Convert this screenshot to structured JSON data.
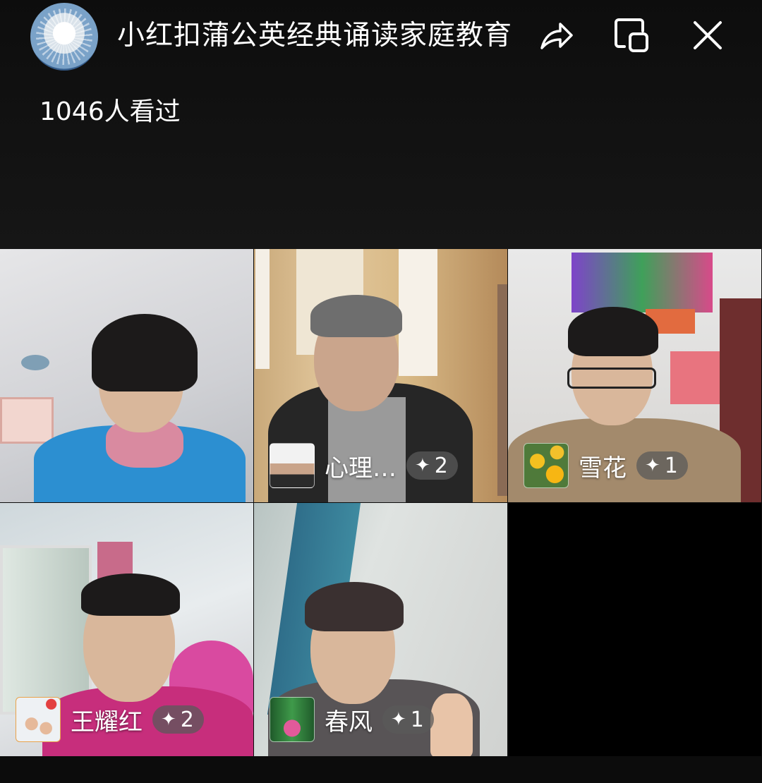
{
  "header": {
    "title": "小红扣蒲公英经典诵读家庭教育",
    "viewers": "1046人看过",
    "avatar_icon": "dandelion-avatar",
    "buttons": {
      "share_icon": "share-icon",
      "float_icon": "floating-window-icon",
      "close_icon": "close-icon"
    }
  },
  "participants": [
    {
      "name": "",
      "badge": ""
    },
    {
      "name": "心理…",
      "badge": "2",
      "avatar_icon": "man-portrait-avatar"
    },
    {
      "name": "雪花",
      "badge": "1",
      "avatar_icon": "yellow-flowers-avatar"
    },
    {
      "name": "王耀红",
      "badge": "2",
      "avatar_icon": "family-photo-avatar"
    },
    {
      "name": "春风",
      "badge": "1",
      "avatar_icon": "lotus-avatar"
    },
    {
      "name": "",
      "badge": ""
    }
  ],
  "badge_symbol": "✦",
  "colors": {
    "background": "#0c0c0c",
    "badge_bg": "#5a5a5a",
    "text": "#ffffff"
  }
}
